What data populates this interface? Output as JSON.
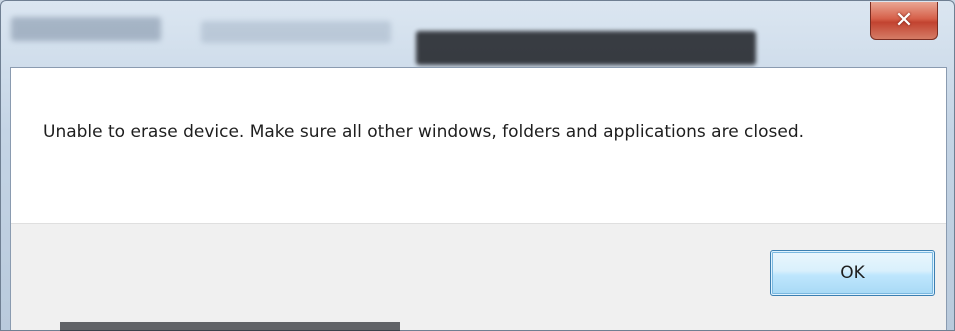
{
  "dialog": {
    "close_icon": "✕",
    "message": "Unable to erase device. Make sure all other windows, folders and applications are closed.",
    "ok_label": "OK"
  },
  "colors": {
    "close_button": "#c8442f",
    "ok_button_border": "#3c7fb1",
    "button_area": "#f0f0f0",
    "content_area": "#ffffff"
  },
  "icons": [
    "close-icon"
  ]
}
